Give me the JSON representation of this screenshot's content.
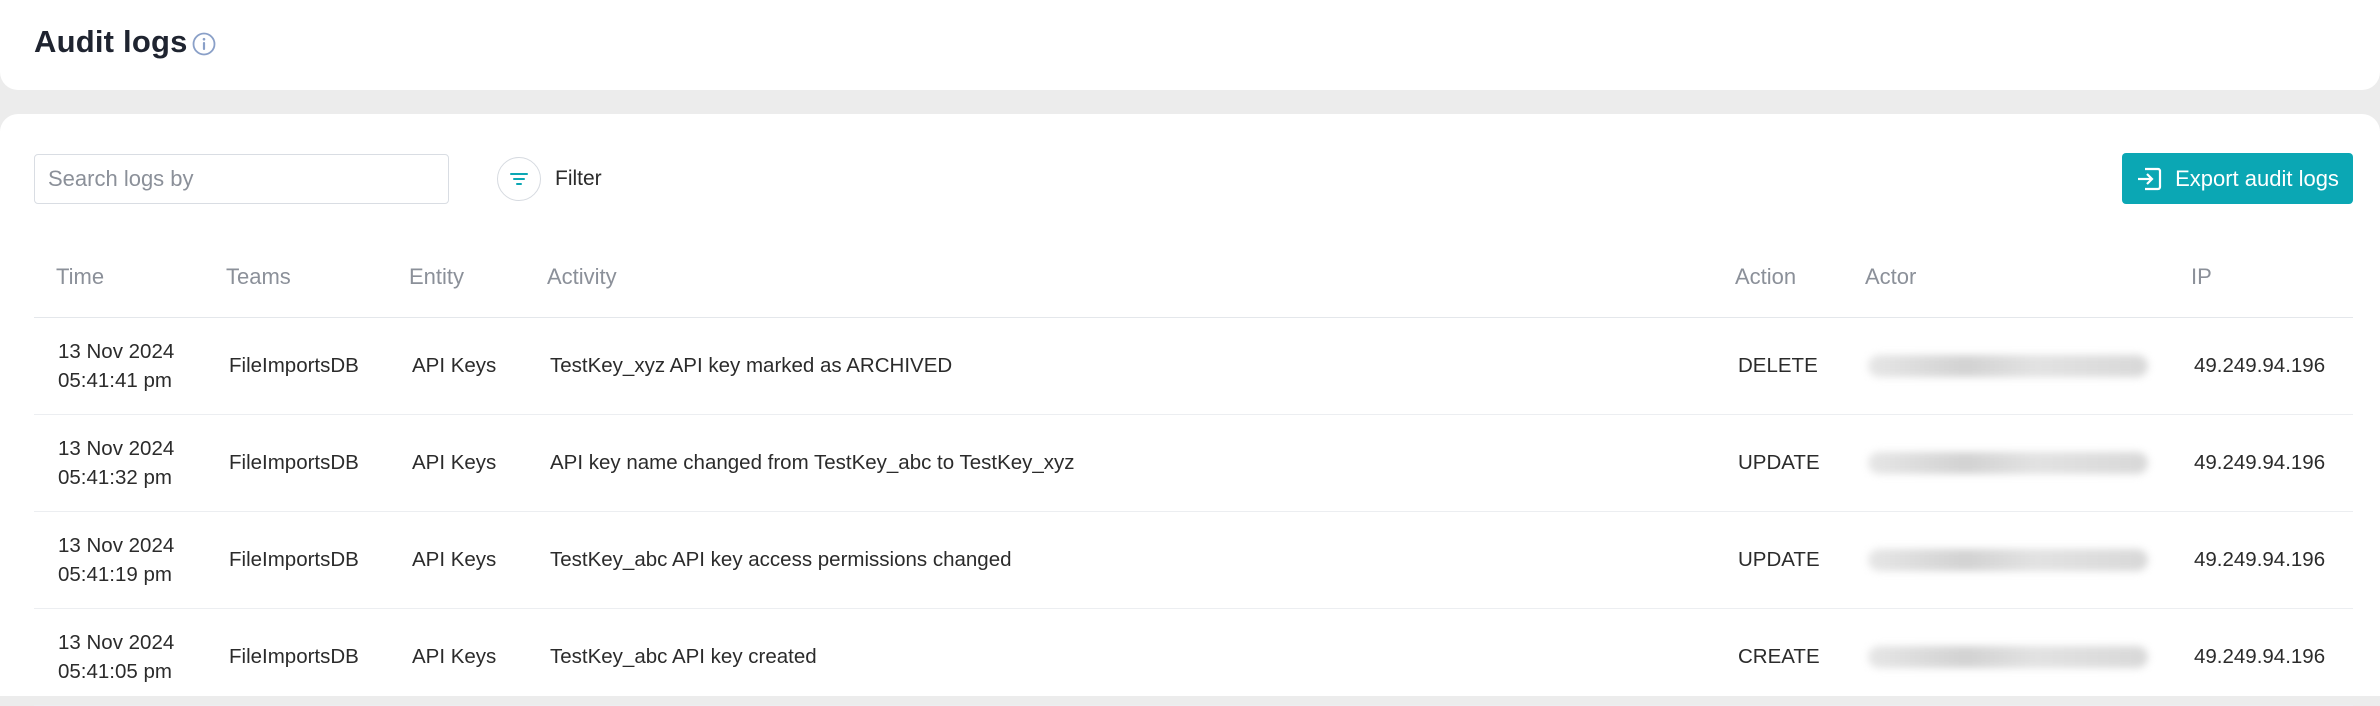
{
  "header": {
    "title": "Audit logs",
    "info_icon": "info-icon"
  },
  "toolbar": {
    "search_placeholder": "Search logs by",
    "filter_label": "Filter",
    "filter_icon": "filter-icon",
    "export_label": "Export audit logs",
    "export_icon": "export-icon",
    "accent_color": "#0ba7b4"
  },
  "table": {
    "columns": [
      "Time",
      "Teams",
      "Entity",
      "Activity",
      "Action",
      "Actor",
      "IP"
    ],
    "rows": [
      {
        "date": "13 Nov 2024",
        "time": "05:41:41 pm",
        "team": "FileImportsDB",
        "entity": "API Keys",
        "activity": "TestKey_xyz API key marked as ARCHIVED",
        "action": "DELETE",
        "actor": "",
        "ip": "49.249.94.196"
      },
      {
        "date": "13 Nov 2024",
        "time": "05:41:32 pm",
        "team": "FileImportsDB",
        "entity": "API Keys",
        "activity": "API key name changed from TestKey_abc to TestKey_xyz",
        "action": "UPDATE",
        "actor": "",
        "ip": "49.249.94.196"
      },
      {
        "date": "13 Nov 2024",
        "time": "05:41:19 pm",
        "team": "FileImportsDB",
        "entity": "API Keys",
        "activity": "TestKey_abc API key access permissions changed",
        "action": "UPDATE",
        "actor": "",
        "ip": "49.249.94.196"
      },
      {
        "date": "13 Nov 2024",
        "time": "05:41:05 pm",
        "team": "FileImportsDB",
        "entity": "API Keys",
        "activity": "TestKey_abc API key created",
        "action": "CREATE",
        "actor": "",
        "ip": "49.249.94.196"
      }
    ]
  }
}
